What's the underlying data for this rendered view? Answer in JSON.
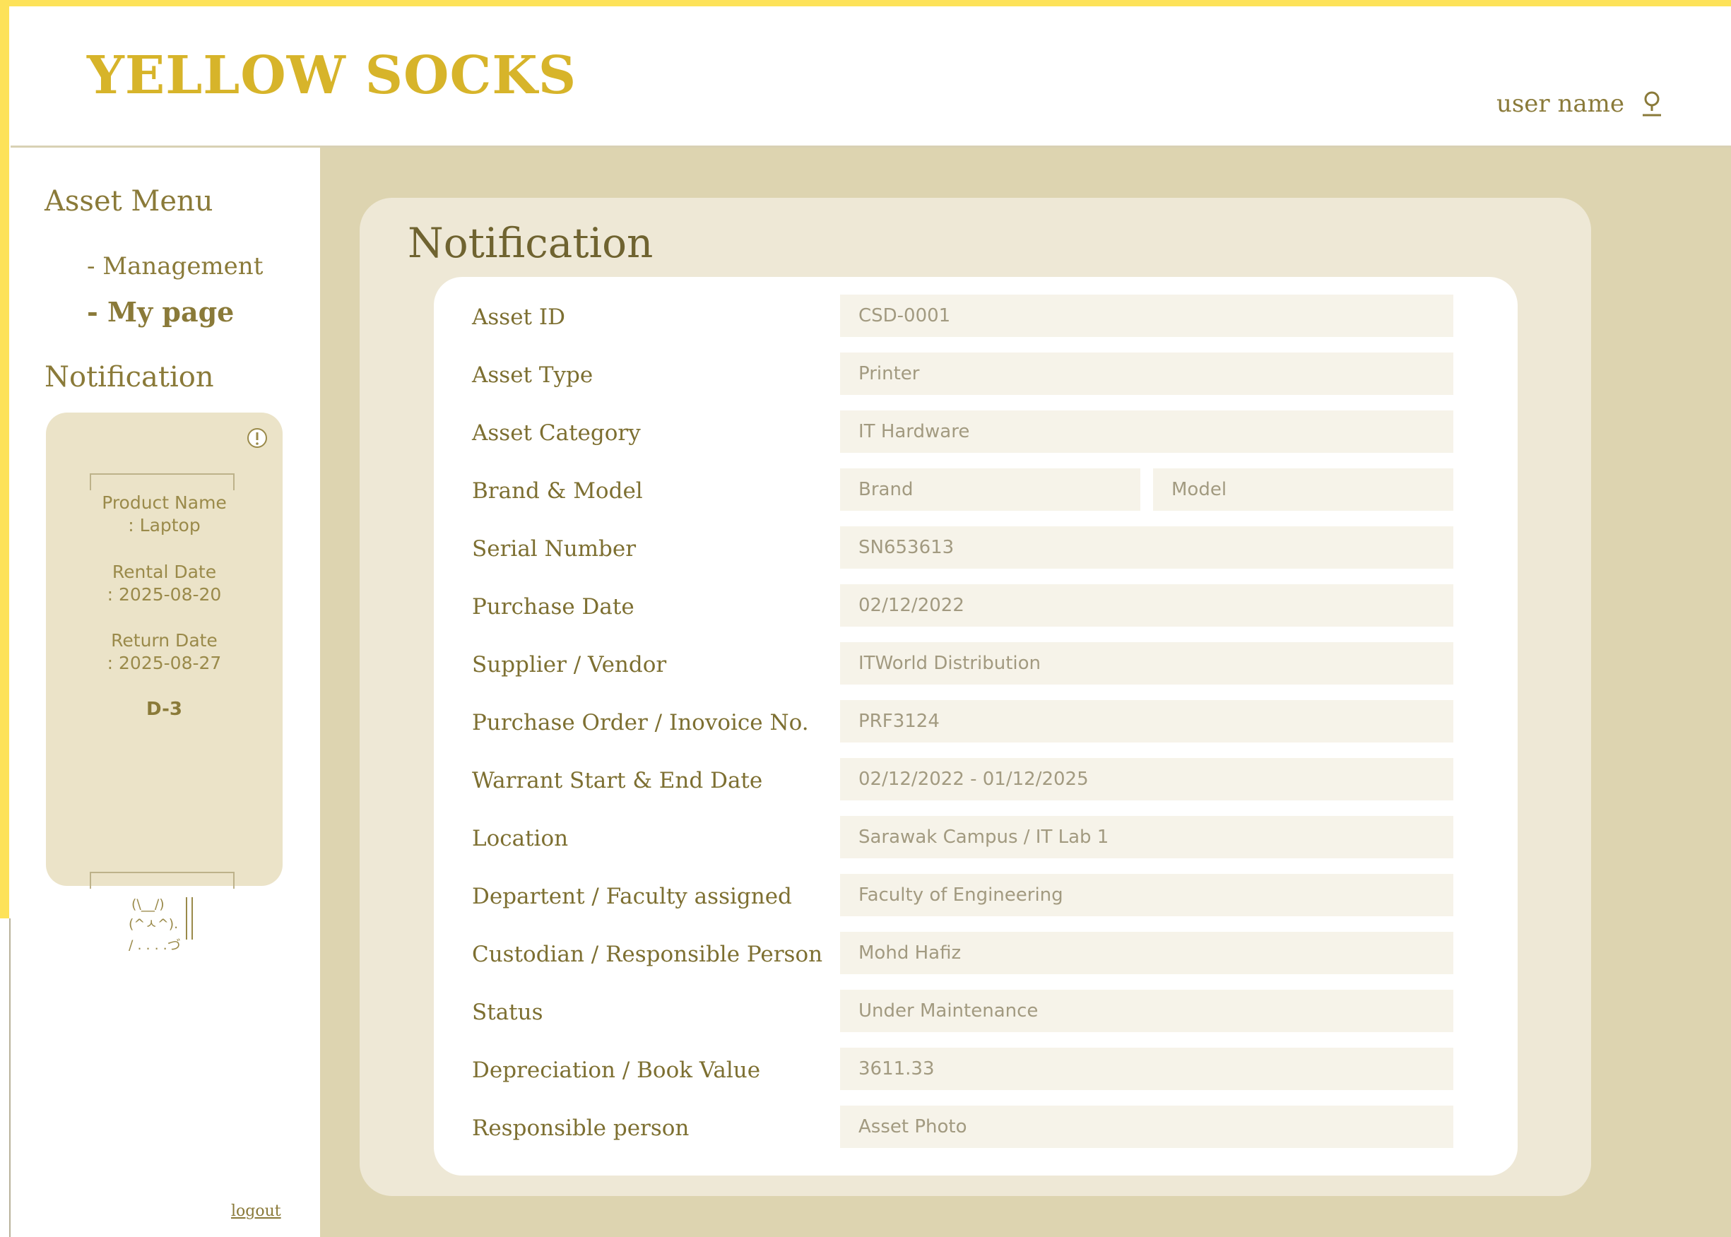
{
  "header": {
    "logo": "YELLOW SOCKS",
    "user_name": "user name",
    "user_icon": "user-icon"
  },
  "sidebar": {
    "asset_menu_heading": "Asset Menu",
    "menu_items": [
      {
        "label": "- Management",
        "active": false
      },
      {
        "label": "- My page",
        "active": true
      }
    ],
    "notification_heading": "Notification",
    "card": {
      "alert_icon": "exclamation-circle-icon",
      "product_name_label": "Product Name",
      "product_name_value": ": Laptop",
      "rental_date_label": "Rental Date",
      "rental_date_value": ": 2025-08-20",
      "return_date_label": "Return Date",
      "return_date_value": ": 2025-08-27",
      "d_day": "D-3",
      "art_line1": "(\\__/)",
      "art_line2": "(^ㅅ^).",
      "art_line3": "/ . . . .づ"
    },
    "logout": "logout"
  },
  "main": {
    "title": "Notification",
    "fields": [
      {
        "label": "Asset ID",
        "value": "CSD-0001"
      },
      {
        "label": "Asset Type",
        "value": "Printer"
      },
      {
        "label": "Asset Category",
        "value": "IT Hardware"
      },
      {
        "label": "Brand & Model",
        "value": "Brand",
        "value2": "Model"
      },
      {
        "label": "Serial Number",
        "value": "SN653613"
      },
      {
        "label": "Purchase Date",
        "value": "02/12/2022"
      },
      {
        "label": "Supplier / Vendor",
        "value": "ITWorld Distribution"
      },
      {
        "label": "Purchase Order / Inovoice No.",
        "value": "PRF3124"
      },
      {
        "label": "Warrant Start & End Date",
        "value": "02/12/2022 - 01/12/2025"
      },
      {
        "label": "Location",
        "value": "Sarawak Campus / IT Lab 1"
      },
      {
        "label": "Departent / Faculty assigned",
        "value": "Faculty of Engineering"
      },
      {
        "label": "Custodian / Responsible Person",
        "value": "Mohd Hafiz"
      },
      {
        "label": "Status",
        "value": "Under Maintenance"
      },
      {
        "label": "Depreciation / Book Value",
        "value": "3611.33"
      },
      {
        "label": "Responsible person",
        "value": "Asset Photo"
      }
    ]
  },
  "colors": {
    "brand_yellow": "#fde259",
    "logo_gold": "#d7b42a",
    "text_olive": "#8a7a39",
    "main_bg": "#ddd4b0",
    "panel_bg": "#eee8d6",
    "card_bg": "#ebe3c8",
    "input_bg": "#f6f3e9"
  }
}
